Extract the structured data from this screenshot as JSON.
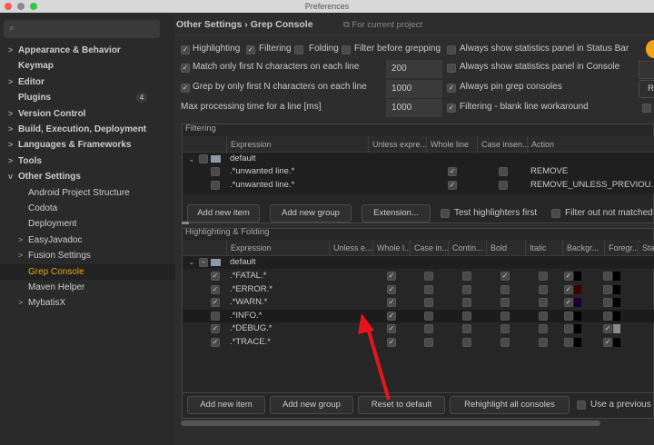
{
  "window": {
    "title": "Preferences"
  },
  "sidebar": {
    "items": [
      {
        "label": "Appearance & Behavior",
        "chevron": ">",
        "level": 0
      },
      {
        "label": "Keymap",
        "chevron": "",
        "level": 0
      },
      {
        "label": "Editor",
        "chevron": ">",
        "level": 0
      },
      {
        "label": "Plugins",
        "chevron": "",
        "level": 0,
        "badge": "4"
      },
      {
        "label": "Version Control",
        "chevron": ">",
        "level": 0
      },
      {
        "label": "Build, Execution, Deployment",
        "chevron": ">",
        "level": 0
      },
      {
        "label": "Languages & Frameworks",
        "chevron": ">",
        "level": 0
      },
      {
        "label": "Tools",
        "chevron": ">",
        "level": 0
      },
      {
        "label": "Other Settings",
        "chevron": "v",
        "level": 0
      },
      {
        "label": "Android Project Structure",
        "chevron": "",
        "level": 1
      },
      {
        "label": "Codota",
        "chevron": "",
        "level": 1
      },
      {
        "label": "Deployment",
        "chevron": "",
        "level": 1
      },
      {
        "label": "EasyJavadoc",
        "chevron": ">",
        "level": 1
      },
      {
        "label": "Fusion Settings",
        "chevron": ">",
        "level": 1
      },
      {
        "label": "Grep Console",
        "chevron": "",
        "level": 1,
        "selected": true
      },
      {
        "label": "Maven Helper",
        "chevron": "",
        "level": 1
      },
      {
        "label": "MybatisX",
        "chevron": ">",
        "level": 1
      }
    ]
  },
  "header": {
    "breadcrumb_parent": "Other Settings",
    "separator": "›",
    "breadcrumb_current": "Grep Console",
    "scope": "For current project"
  },
  "options": {
    "highlighting": "Highlighting",
    "filtering": "Filtering",
    "folding": "Folding",
    "filter_before": "Filter before grepping",
    "stats_status_bar": "Always show statistics panel in Status Bar",
    "match_first_n": "Match only first N characters on each line",
    "match_first_n_value": "200",
    "stats_console": "Always show statistics panel in Console",
    "grep_first_n": "Grep by only first N characters on each line",
    "grep_first_n_value": "1000",
    "pin_consoles": "Always pin grep consoles",
    "max_time": "Max processing time for a line [ms]",
    "max_time_value": "1000",
    "blank_line": "Filtering - blank line workaround",
    "cut_button": "R"
  },
  "filtering": {
    "title": "Filtering",
    "columns": [
      "Expression",
      "Unless expre...",
      "Whole line",
      "Case insen...",
      "Action"
    ],
    "group": "default",
    "rows": [
      {
        "expression": ".*unwanted line.*",
        "enabled": false,
        "whole_line": true,
        "case_insensitive": false,
        "action": "REMOVE"
      },
      {
        "expression": ".*unwanted line.*",
        "enabled": false,
        "whole_line": true,
        "case_insensitive": false,
        "action": "REMOVE_UNLESS_PREVIOU..."
      }
    ],
    "buttons": {
      "add_item": "Add new item",
      "add_group": "Add new group",
      "extension": "Extension..."
    },
    "test_first": "Test highlighters first",
    "filter_out": "Filter out not matched"
  },
  "highlighting": {
    "title": "Highlighting & Folding",
    "columns": [
      "Expression",
      "Unless e...",
      "Whole l...",
      "Case in...",
      "Contin...",
      "Bold",
      "Italic",
      "Backgr...",
      "Foregr...",
      "Sta"
    ],
    "group": "default",
    "rows": [
      {
        "expression": ".*FATAL.*",
        "enabled": true,
        "whole": true,
        "case": false,
        "cont": false,
        "bold": true,
        "italic": false,
        "bg": true,
        "bg_color": "#000000",
        "fg": false,
        "fg_color": "#000000"
      },
      {
        "expression": ".*ERROR.*",
        "enabled": true,
        "whole": true,
        "case": false,
        "cont": false,
        "bold": false,
        "italic": false,
        "bg": true,
        "bg_color": "#3a0000",
        "fg": false,
        "fg_color": "#000000"
      },
      {
        "expression": ".*WARN.*",
        "enabled": true,
        "whole": true,
        "case": false,
        "cont": false,
        "bold": false,
        "italic": false,
        "bg": true,
        "bg_color": "#1a0033",
        "fg": false,
        "fg_color": "#000000"
      },
      {
        "expression": ".*INFO.*",
        "enabled": false,
        "whole": true,
        "case": false,
        "cont": false,
        "bold": false,
        "italic": false,
        "bg": false,
        "bg_color": "#000000",
        "fg": false,
        "fg_color": "#000000"
      },
      {
        "expression": ".*DEBUG.*",
        "enabled": true,
        "whole": true,
        "case": false,
        "cont": false,
        "bold": false,
        "italic": false,
        "bg": false,
        "bg_color": "#000000",
        "fg": true,
        "fg_color": "#888888"
      },
      {
        "expression": ".*TRACE.*",
        "enabled": true,
        "whole": true,
        "case": false,
        "cont": false,
        "bold": false,
        "italic": false,
        "bg": false,
        "bg_color": "#000000",
        "fg": true,
        "fg_color": "#000000"
      }
    ],
    "buttons": {
      "add_item": "Add new item",
      "add_group": "Add new group",
      "reset": "Reset to default",
      "rehighlight": "Rehighlight all consoles"
    },
    "use_previous": "Use a previous"
  },
  "colors": {
    "accent": "#e8a617",
    "annotation": "#e8141c"
  }
}
